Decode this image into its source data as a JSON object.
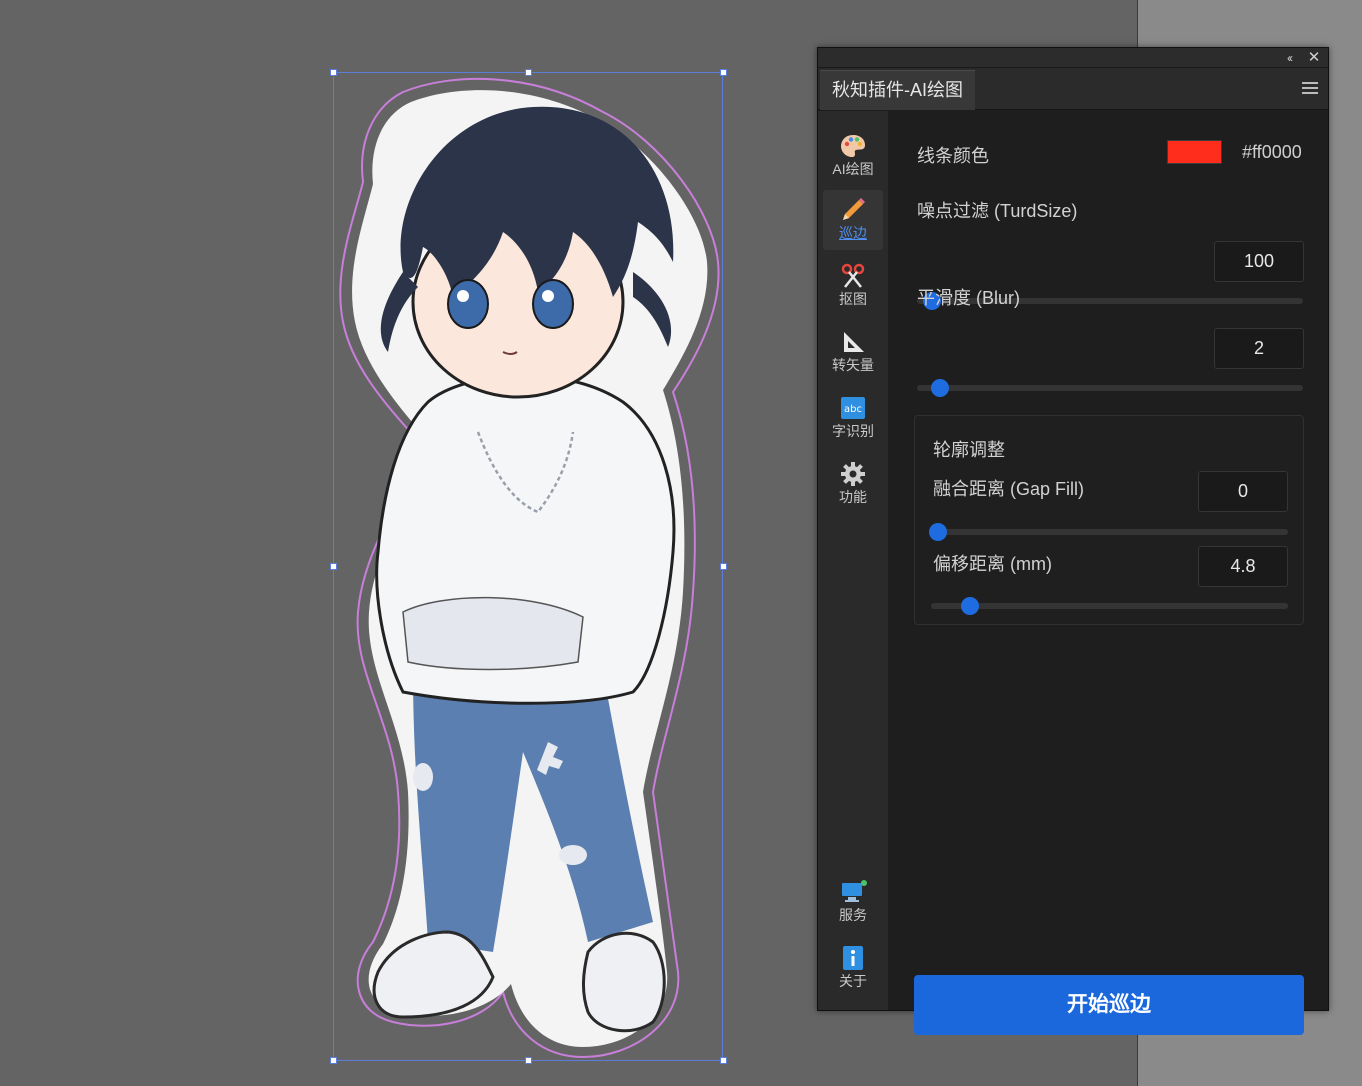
{
  "panel": {
    "tab_title": "秋知插件-AI绘图",
    "collapse_icon": "double-chevron-left-icon",
    "close_icon": "close-icon",
    "menu_icon": "hamburger-menu-icon"
  },
  "sidebar": {
    "items": [
      {
        "label": "AI绘图",
        "icon": "palette-icon",
        "active": false
      },
      {
        "label": "巡边",
        "icon": "pencil-icon",
        "active": true
      },
      {
        "label": "抠图",
        "icon": "scissors-icon",
        "active": false
      },
      {
        "label": "转矢量",
        "icon": "triangle-ruler-icon",
        "active": false
      },
      {
        "label": "字识别",
        "icon": "abc-text-icon",
        "active": false
      },
      {
        "label": "功能",
        "icon": "gear-icon",
        "active": false
      }
    ],
    "bottom_items": [
      {
        "label": "服务",
        "icon": "monitor-status-icon"
      },
      {
        "label": "关于",
        "icon": "info-icon"
      }
    ]
  },
  "settings": {
    "line_color_label": "线条颜色",
    "line_color_value": "#ff0000",
    "line_color_swatch": "#ff2d1c",
    "turdsize_label": "噪点过滤 (TurdSize)",
    "turdsize_value": "100",
    "turdsize_slider_fraction": 0.04,
    "blur_label": "平滑度 (Blur)",
    "blur_value": "2",
    "blur_slider_fraction": 0.06,
    "contour": {
      "title": "轮廓调整",
      "gap_fill_label": "融合距离 (Gap Fill)",
      "gap_fill_value": "0",
      "gap_fill_slider_fraction": 0.02,
      "offset_label": "偏移距离 (mm)",
      "offset_value": "4.8",
      "offset_slider_fraction": 0.11
    }
  },
  "actions": {
    "start_label": "开始巡边"
  },
  "colors": {
    "accent": "#1b68dd",
    "canvas": "#646464",
    "panel_bg": "#1e1e1e",
    "outline": "#c77fd9"
  }
}
